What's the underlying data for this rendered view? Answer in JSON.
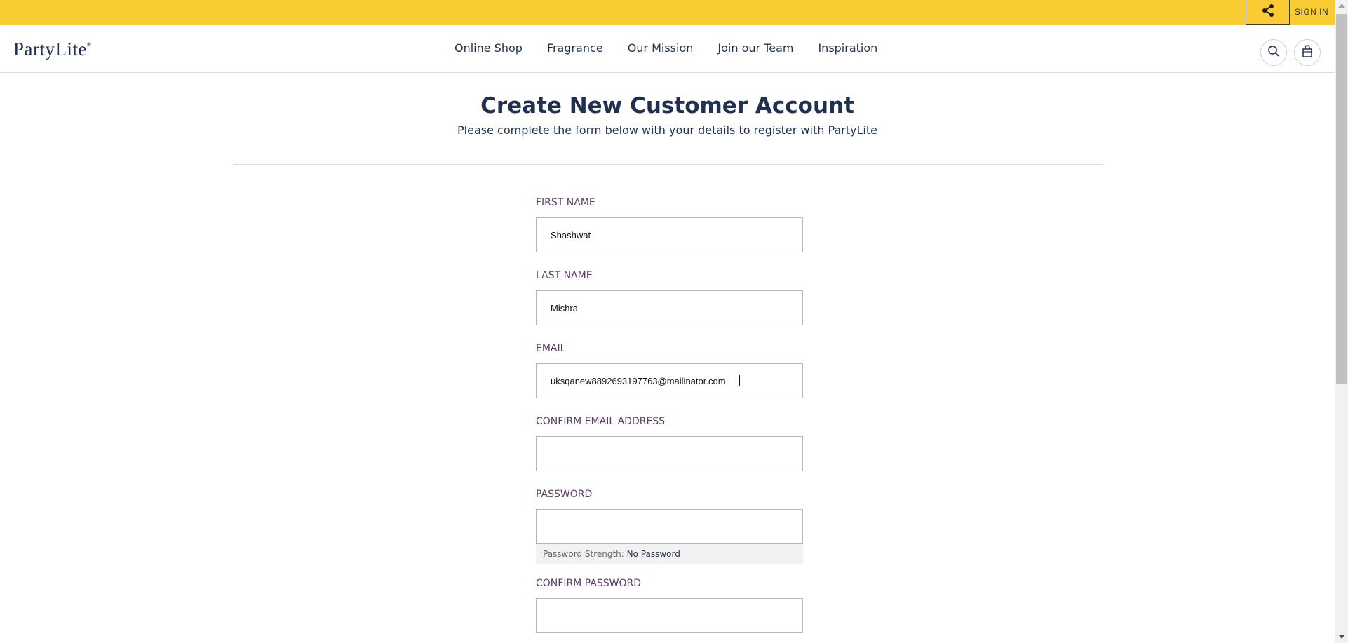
{
  "topbar": {
    "signin": "SIGN IN"
  },
  "header": {
    "logo": "PartyLite",
    "logo_mark": "®",
    "nav": [
      "Online Shop",
      "Fragrance",
      "Our Mission",
      "Join our Team",
      "Inspiration"
    ]
  },
  "page": {
    "title": "Create New Customer Account",
    "subtitle": "Please complete the form below with your details to register with PartyLite"
  },
  "form": {
    "first_name": {
      "label": "FIRST NAME",
      "value": "Shashwat"
    },
    "last_name": {
      "label": "LAST NAME",
      "value": "Mishra"
    },
    "email": {
      "label": "EMAIL",
      "value": "uksqanew8892693197763@mailinator.com"
    },
    "confirm_email": {
      "label": "CONFIRM EMAIL ADDRESS",
      "value": ""
    },
    "password": {
      "label": "PASSWORD",
      "value": ""
    },
    "password_strength": {
      "label": "Password Strength:",
      "value": "No Password"
    },
    "confirm_password": {
      "label": "CONFIRM PASSWORD",
      "value": ""
    }
  },
  "colors": {
    "topbar": "#f8cc32",
    "brand_navy": "#1f3050",
    "label": "#5b3b64"
  },
  "icons": {
    "share": "share-icon",
    "search": "search-icon",
    "bag": "shopping-bag-icon"
  }
}
